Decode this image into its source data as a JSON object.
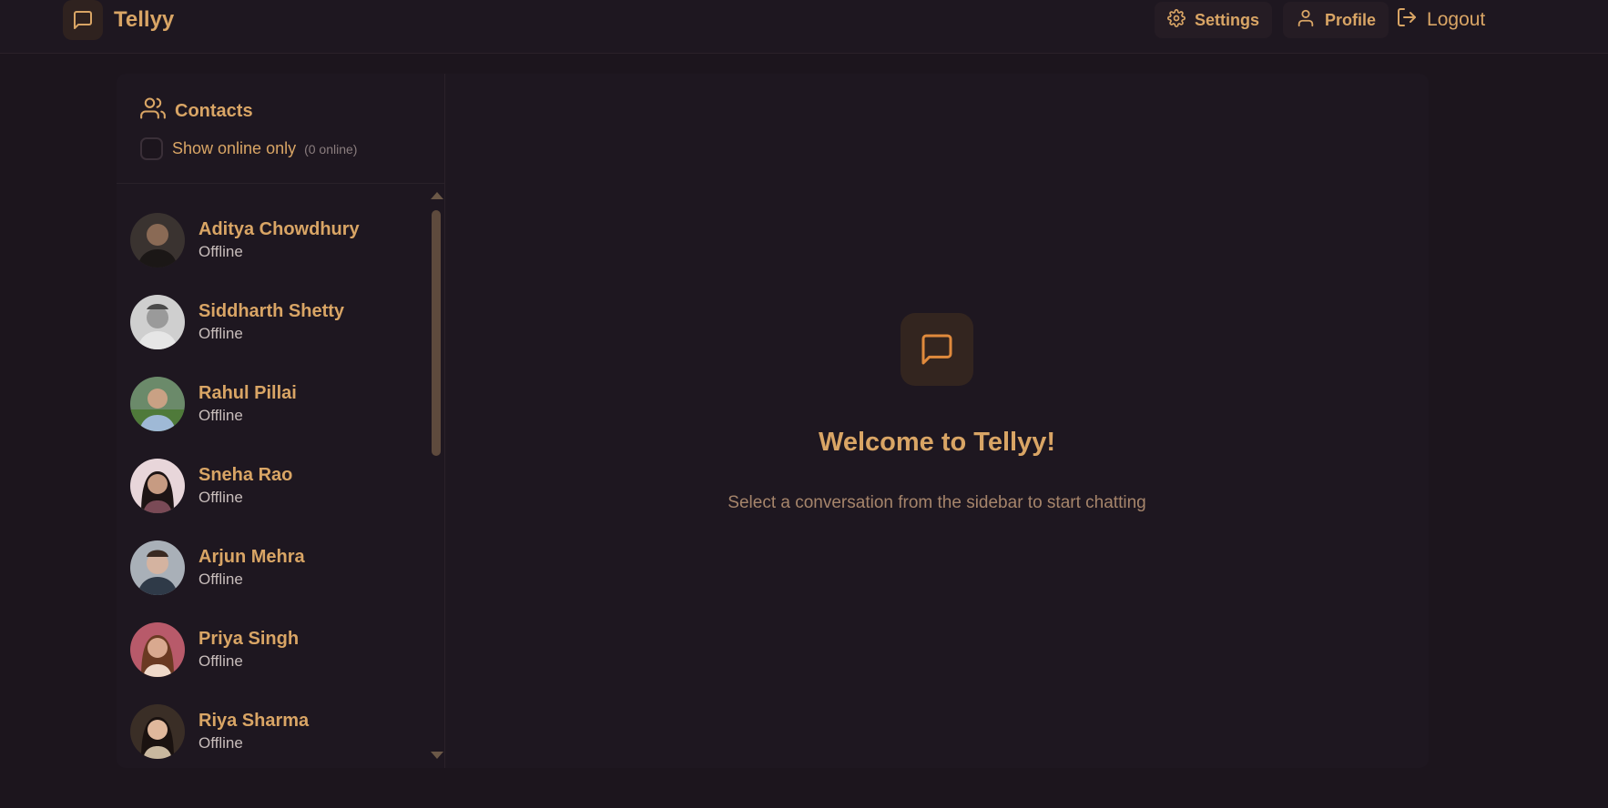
{
  "app": {
    "name": "Tellyy"
  },
  "nav": {
    "settings": "Settings",
    "profile": "Profile",
    "logout": "Logout"
  },
  "sidebar": {
    "title": "Contacts",
    "filter_label": "Show online only",
    "online_count": "(0 online)",
    "contacts": [
      {
        "name": "Aditya Chowdhury",
        "status": "Offline"
      },
      {
        "name": "Siddharth Shetty",
        "status": "Offline"
      },
      {
        "name": "Rahul Pillai",
        "status": "Offline"
      },
      {
        "name": "Sneha Rao",
        "status": "Offline"
      },
      {
        "name": "Arjun Mehra",
        "status": "Offline"
      },
      {
        "name": "Priya Singh",
        "status": "Offline"
      },
      {
        "name": "Riya Sharma",
        "status": "Offline"
      }
    ]
  },
  "welcome": {
    "title": "Welcome to Tellyy!",
    "subtitle": "Select a conversation from the sidebar to start chatting"
  },
  "colors": {
    "accent": "#d9a565",
    "background": "#1c151d",
    "panel": "#1e1720"
  }
}
